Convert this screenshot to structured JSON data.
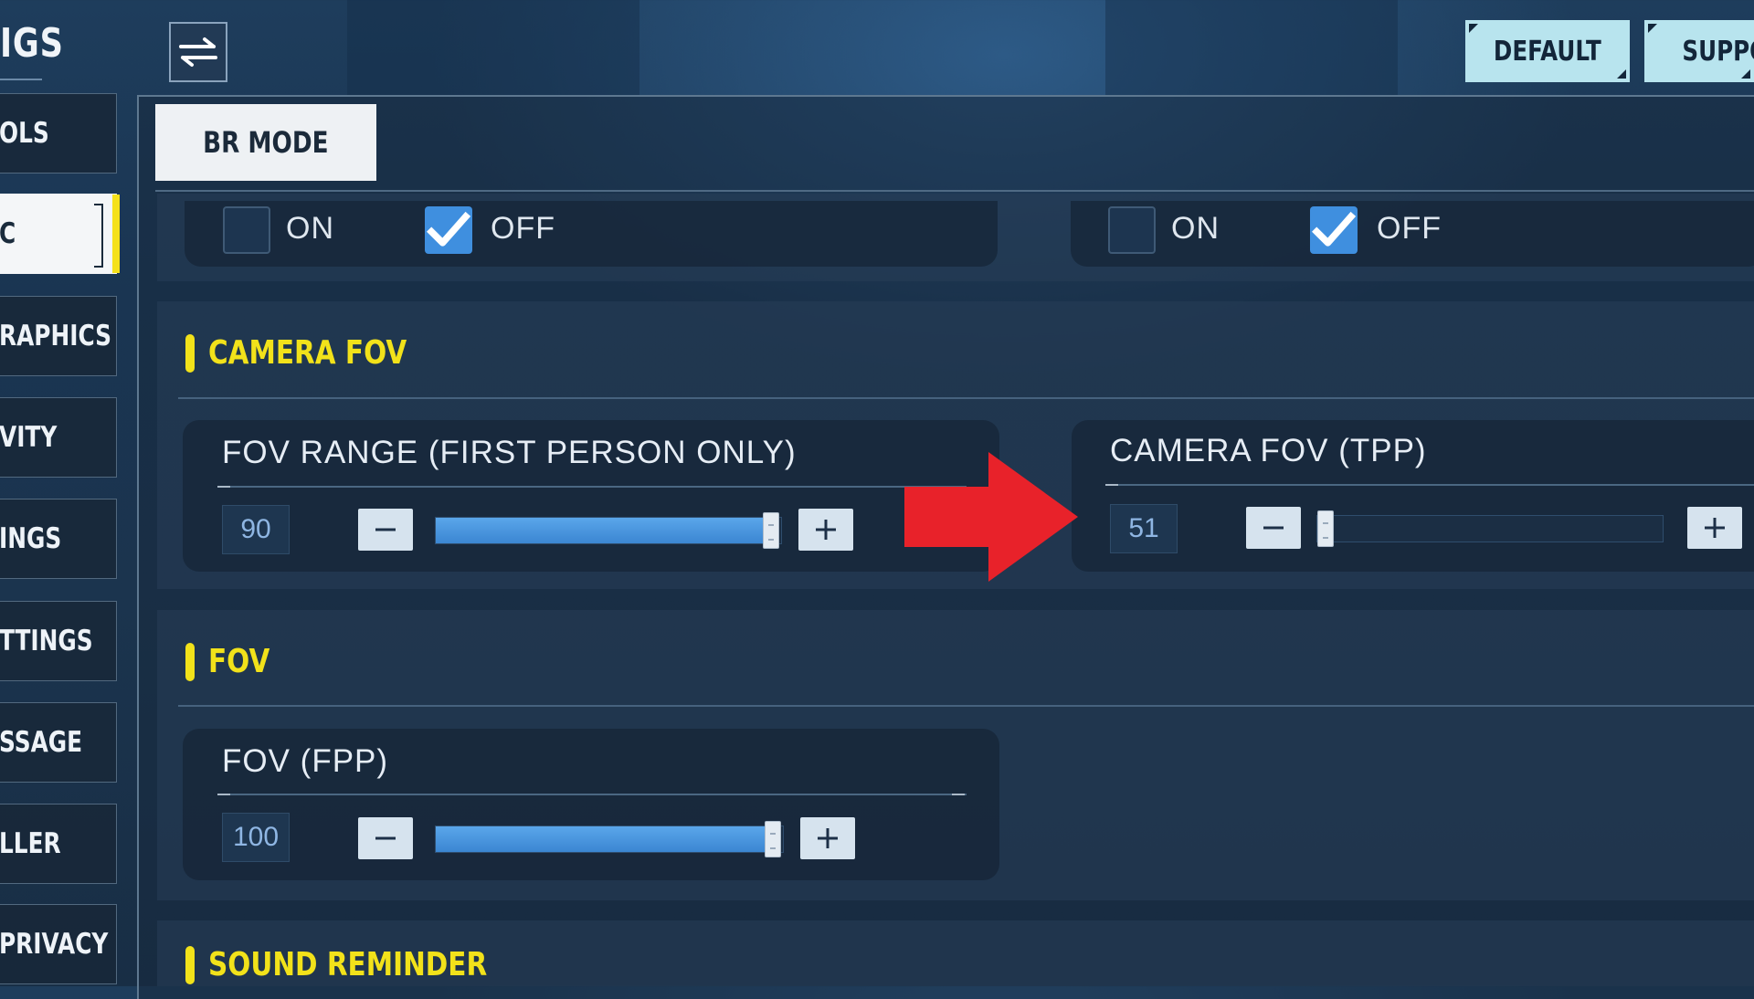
{
  "header": {
    "title": "IGS",
    "default_label": "DEFAULT",
    "support_label": "SUPPOI"
  },
  "sidebar": {
    "items": [
      {
        "label": "OLS"
      },
      {
        "label": "C",
        "active": true
      },
      {
        "label": "RAPHICS"
      },
      {
        "label": "VITY"
      },
      {
        "label": "INGS"
      },
      {
        "label": "TTINGS"
      },
      {
        "label": "SSAGE"
      },
      {
        "label": "LLER"
      },
      {
        "label": "PRIVACY"
      }
    ]
  },
  "mode_tab": {
    "label": "BR MODE"
  },
  "toggles": {
    "left": {
      "on_label": "ON",
      "off_label": "OFF",
      "selected": "OFF"
    },
    "right": {
      "on_label": "ON",
      "off_label": "OFF",
      "selected": "OFF"
    }
  },
  "sections": {
    "camera_fov": {
      "title": "CAMERA FOV",
      "fov_range": {
        "label": "FOV RANGE (FIRST PERSON ONLY)",
        "value": "90",
        "fill_fraction": 0.97
      },
      "camera_fov_tpp": {
        "label": "CAMERA FOV (TPP)",
        "value": "51",
        "fill_fraction": 0.0
      }
    },
    "fov": {
      "title": "FOV",
      "fov_fpp": {
        "label": "FOV (FPP)",
        "value": "100",
        "fill_fraction": 0.97
      }
    },
    "sound_reminder": {
      "title": "SOUND REMINDER"
    }
  },
  "colors": {
    "accent_yellow": "#f2e21a",
    "slider_blue": "#4a96e0",
    "annotation_red": "#e8222a",
    "button_light": "#b8e4ee"
  },
  "icons": [
    "swap-arrows-icon",
    "checkmark-icon",
    "minus-icon",
    "plus-icon",
    "red-arrow-annotation"
  ]
}
